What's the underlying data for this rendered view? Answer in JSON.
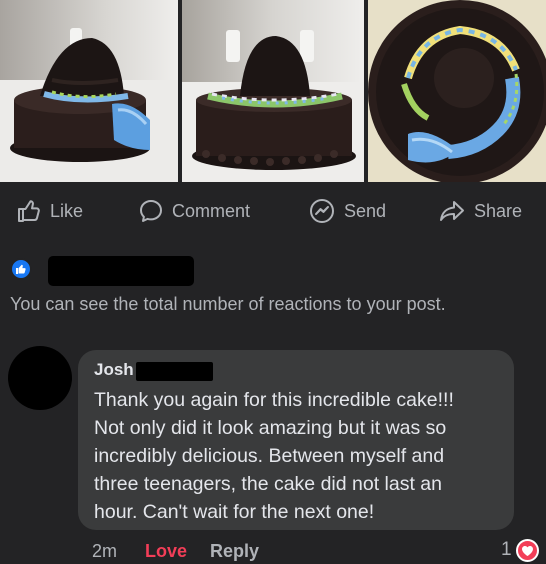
{
  "photos": [
    {
      "name": "cake-photo-side"
    },
    {
      "name": "cake-photo-front"
    },
    {
      "name": "cake-photo-top"
    }
  ],
  "actions": {
    "like": {
      "label": "Like",
      "icon": "thumbs-up-icon"
    },
    "comment": {
      "label": "Comment",
      "icon": "speech-bubble-icon"
    },
    "send": {
      "label": "Send",
      "icon": "messenger-icon"
    },
    "share": {
      "label": "Share",
      "icon": "share-arrow-icon"
    }
  },
  "reactions": {
    "icon": "like-reaction-icon",
    "note": "You can see the total number of reactions to your post."
  },
  "comment": {
    "author": "Josh",
    "lines": [
      "Thank you again for this incredible cake!!!",
      "Not only did it look amazing but it was so",
      "incredibly delicious.  Between myself and",
      "three teenagers, the cake did not last an",
      "hour.  Can't wait for the next one!"
    ],
    "time": "2m",
    "love_label": "Love",
    "reply_label": "Reply",
    "reaction_count": "1",
    "reaction_icon": "heart-icon"
  },
  "colors": {
    "background": "#232325",
    "bubble": "#3a3b3c",
    "love": "#f33e58",
    "like_blue": "#1877f2"
  }
}
